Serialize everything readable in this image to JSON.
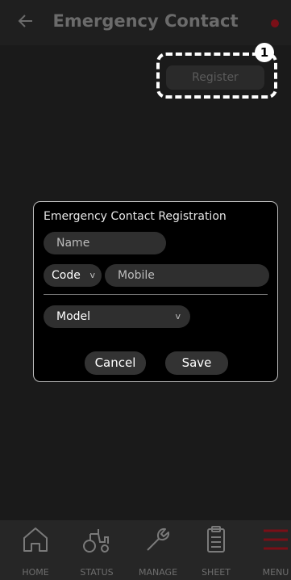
{
  "header": {
    "title": "Emergency Contact"
  },
  "register": {
    "label": "Register",
    "step_badge": "1"
  },
  "dialog": {
    "title": "Emergency Contact Registration",
    "name_placeholder": "Name",
    "code_value": "Code",
    "mobile_placeholder": "Mobile",
    "model_value": "Model",
    "cancel_label": "Cancel",
    "save_label": "Save"
  },
  "nav": {
    "home": "HOME",
    "status": "STATUS",
    "manage": "MANAGE",
    "sheet": "SHEET",
    "menu": "MENU"
  },
  "colors": {
    "accent_red": "#7a0f17",
    "background": "#1a1a1a"
  },
  "icons": [
    "back-arrow-icon",
    "home-icon",
    "tractor-icon",
    "wrench-icon",
    "clipboard-icon",
    "hamburger-menu-icon",
    "chevron-down-icon"
  ]
}
